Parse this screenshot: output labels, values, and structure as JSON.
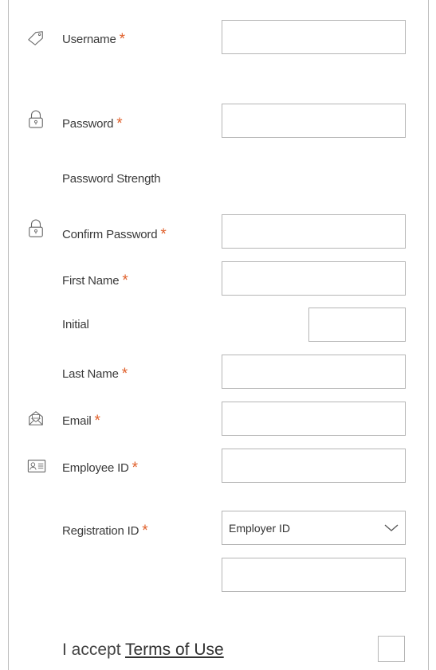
{
  "form": {
    "username": {
      "label": "Username",
      "required_mark": "*",
      "value": "",
      "icon": "tag-icon"
    },
    "password": {
      "label": "Password",
      "required_mark": "*",
      "value": "",
      "icon": "lock-icon"
    },
    "password_strength": {
      "label": "Password Strength"
    },
    "confirm_password": {
      "label": "Confirm Password",
      "required_mark": "*",
      "value": "",
      "icon": "lock-icon"
    },
    "first_name": {
      "label": "First Name",
      "required_mark": "*",
      "value": ""
    },
    "initial": {
      "label": "Initial",
      "value": ""
    },
    "last_name": {
      "label": "Last Name",
      "required_mark": "*",
      "value": ""
    },
    "email": {
      "label": "Email",
      "required_mark": "*",
      "value": "",
      "icon": "envelope-icon"
    },
    "employee_id": {
      "label": "Employee ID",
      "required_mark": "*",
      "value": "",
      "icon": "id-card-icon"
    },
    "registration_id": {
      "label": "Registration ID",
      "required_mark": "*",
      "selected": "Employer ID",
      "value": ""
    },
    "terms": {
      "prefix": "I accept ",
      "link_label": "Terms of Use",
      "checked": false
    }
  },
  "colors": {
    "required": "#e0602b",
    "border": "#b5b5b5",
    "text": "#3a3a3a"
  }
}
